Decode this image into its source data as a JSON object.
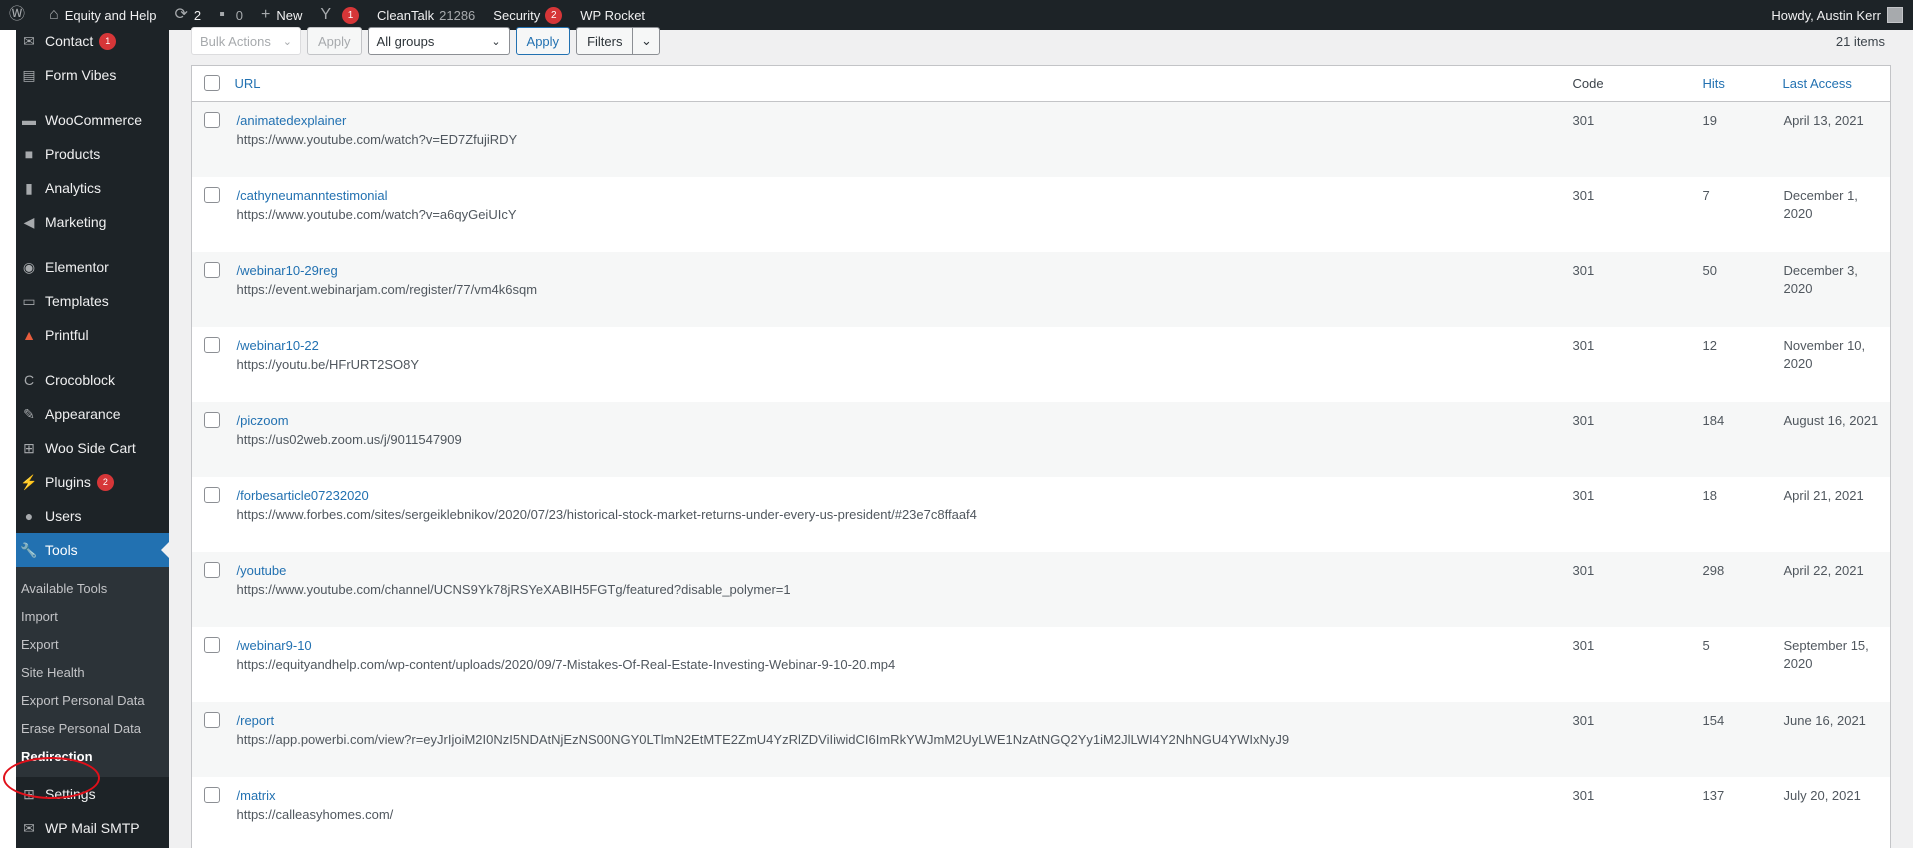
{
  "adminbar": {
    "site_name": "Equity and Help",
    "updates_count": "2",
    "comments_count": "0",
    "new_label": "New",
    "yoast_count": "1",
    "cleantalk_label": "CleanTalk",
    "cleantalk_count": "21286",
    "security_label": "Security",
    "security_count": "2",
    "wprocket_label": "WP Rocket",
    "howdy": "Howdy, Austin Kerr"
  },
  "sidebar": {
    "contact": {
      "label": "Contact",
      "badge": "1"
    },
    "form_vibes": "Form Vibes",
    "woocommerce": "WooCommerce",
    "products": "Products",
    "analytics": "Analytics",
    "marketing": "Marketing",
    "elementor": "Elementor",
    "templates": "Templates",
    "printful": "Printful",
    "crocoblock": "Crocoblock",
    "appearance": "Appearance",
    "woo_side_cart": "Woo Side Cart",
    "plugins": {
      "label": "Plugins",
      "badge": "2"
    },
    "users": "Users",
    "tools": "Tools",
    "submenu": [
      "Available Tools",
      "Import",
      "Export",
      "Site Health",
      "Export Personal Data",
      "Erase Personal Data",
      "Redirection"
    ],
    "settings": "Settings",
    "wp_mail_smtp": "WP Mail SMTP"
  },
  "toolbar": {
    "bulk_actions": "Bulk Actions",
    "apply1": "Apply",
    "group_select": "All groups",
    "apply2": "Apply",
    "filters": "Filters",
    "items_count": "21 items"
  },
  "table": {
    "headers": {
      "url": "URL",
      "code": "Code",
      "hits": "Hits",
      "last_access": "Last Access"
    },
    "rows": [
      {
        "source": "/animatedexplainer",
        "target": "https://www.youtube.com/watch?v=ED7ZfujiRDY",
        "code": "301",
        "hits": "19",
        "last": "April 13, 2021"
      },
      {
        "source": "/cathyneumanntestimonial",
        "target": "https://www.youtube.com/watch?v=a6qyGeiUIcY",
        "code": "301",
        "hits": "7",
        "last": "December 1, 2020"
      },
      {
        "source": "/webinar10-29reg",
        "target": "https://event.webinarjam.com/register/77/vm4k6sqm",
        "code": "301",
        "hits": "50",
        "last": "December 3, 2020"
      },
      {
        "source": "/webinar10-22",
        "target": "https://youtu.be/HFrURT2SO8Y",
        "code": "301",
        "hits": "12",
        "last": "November 10, 2020"
      },
      {
        "source": "/piczoom",
        "target": "https://us02web.zoom.us/j/9011547909",
        "code": "301",
        "hits": "184",
        "last": "August 16, 2021"
      },
      {
        "source": "/forbesarticle07232020",
        "target": "https://www.forbes.com/sites/sergeiklebnikov/2020/07/23/historical-stock-market-returns-under-every-us-president/#23e7c8ffaaf4",
        "code": "301",
        "hits": "18",
        "last": "April 21, 2021"
      },
      {
        "source": "/youtube",
        "target": "https://www.youtube.com/channel/UCNS9Yk78jRSYeXABIH5FGTg/featured?disable_polymer=1",
        "code": "301",
        "hits": "298",
        "last": "April 22, 2021"
      },
      {
        "source": "/webinar9-10",
        "target": "https://equityandhelp.com/wp-content/uploads/2020/09/7-Mistakes-Of-Real-Estate-Investing-Webinar-9-10-20.mp4",
        "code": "301",
        "hits": "5",
        "last": "September 15, 2020"
      },
      {
        "source": "/report",
        "target": "https://app.powerbi.com/view?r=eyJrIjoiM2I0NzI5NDAtNjEzNS00NGY0LTlmN2EtMTE2ZmU4YzRlZDViIiwidCI6ImRkYWJmM2UyLWE1NzAtNGQ2Yy1iM2JlLWI4Y2NhNGU4YWIxNyJ9",
        "code": "301",
        "hits": "154",
        "last": "June 16, 2021"
      },
      {
        "source": "/matrix",
        "target": "https://calleasyhomes.com/",
        "code": "301",
        "hits": "137",
        "last": "July 20, 2021"
      }
    ]
  }
}
